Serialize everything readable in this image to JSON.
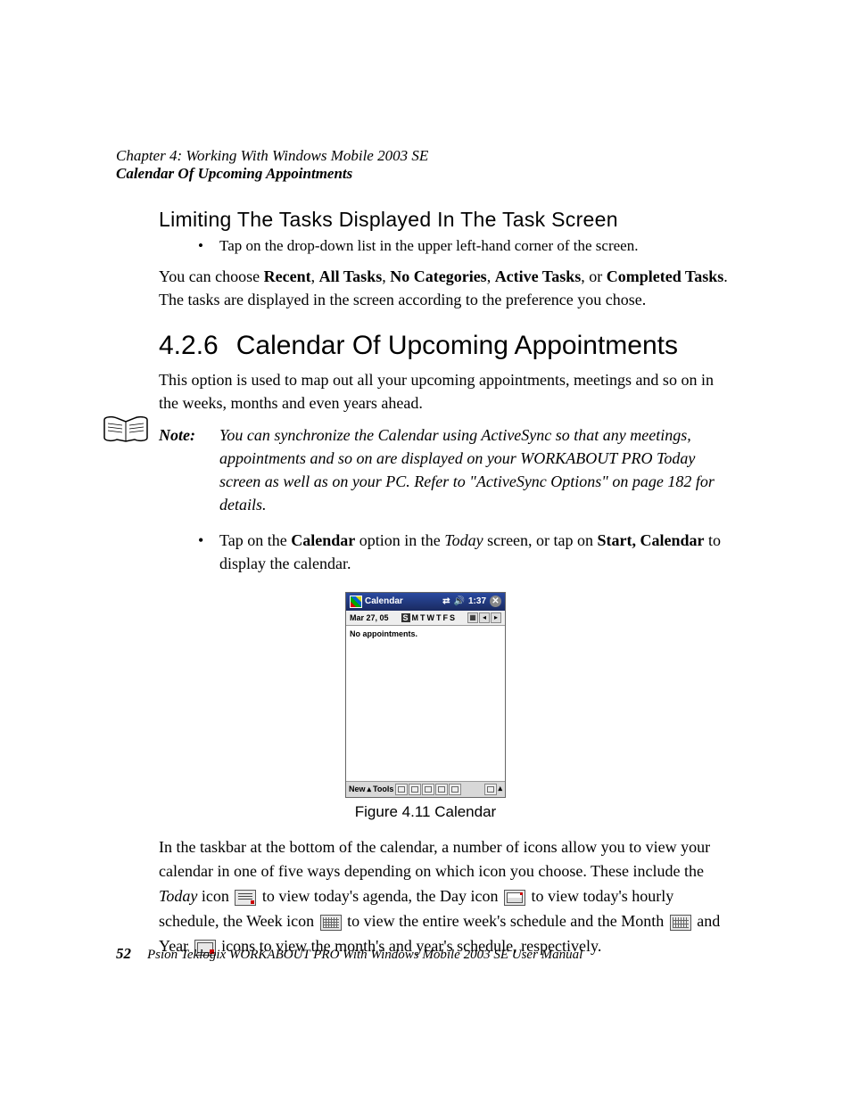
{
  "header": {
    "chapter_line": "Chapter 4: Working With Windows Mobile 2003 SE",
    "section_line": "Calendar Of Upcoming Appointments"
  },
  "subhead": "Limiting The Tasks Displayed In The Task Screen",
  "bullet1": "Tap on the drop-down list in the upper left-hand corner of the screen.",
  "para1_a": "You can choose ",
  "para1_recent": "Recent",
  "para1_b": ", ",
  "para1_all": "All Tasks",
  "para1_c": ", ",
  "para1_nocat": "No Categories",
  "para1_d": ", ",
  "para1_active": "Active Tasks",
  "para1_e": ", or ",
  "para1_completed": "Completed Tasks",
  "para1_f": ". The tasks are displayed in the screen according to the preference you chose.",
  "h2_num": "4.2.6",
  "h2_text": "Calendar Of Upcoming Appointments",
  "para2": "This option is used to map out all your upcoming appointments, meetings and so on in the weeks, months and even years ahead.",
  "note_label": "Note:",
  "note_text": "You can synchronize the Calendar using ActiveSync so that any meetings, appointments and so on are displayed on your WORKABOUT PRO Today screen as well as on your PC. Refer to \"ActiveSync Options\" on page 182 for details.",
  "bullet2_a": "Tap on the ",
  "bullet2_cal": "Calendar",
  "bullet2_b": " option in the ",
  "bullet2_today": "Today",
  "bullet2_c": " screen, or tap on ",
  "bullet2_start": "Start, Calendar",
  "bullet2_d": " to display the calendar.",
  "screenshot": {
    "title": "Calendar",
    "time": "1:37",
    "date": "Mar 27, 05",
    "days": [
      "S",
      "M",
      "T",
      "W",
      "T",
      "F",
      "S"
    ],
    "body": "No appointments.",
    "new": "New",
    "tools": "Tools"
  },
  "fig_caption": "Figure 4.11 Calendar",
  "body_a": "In the taskbar at the bottom of the calendar, a number of icons allow you to view your calendar in one of five ways depending on which icon you choose. These include the ",
  "body_today_i": "Today",
  "body_b": " icon ",
  "body_c": " to view today's agenda, the Day icon ",
  "body_d": " to view today's hourly schedule, the Week icon ",
  "body_e": " to view the entire week's schedule and the Month ",
  "body_f": " and Year ",
  "body_g": " icons to view the month's and year's schedule, respectively.",
  "footer": {
    "page": "52",
    "text": "Psion Teklogix WORKABOUT PRO With Windows Mobile 2003 SE User Manual"
  }
}
